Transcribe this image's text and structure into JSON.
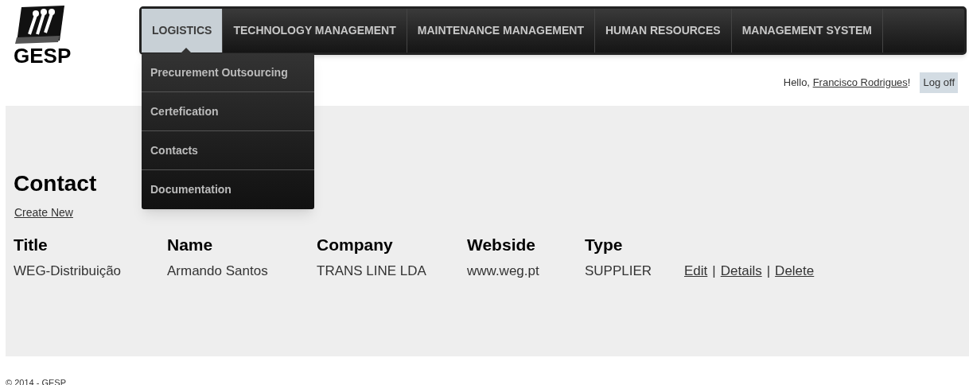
{
  "logo": {
    "text": "GESP"
  },
  "nav": [
    {
      "label": "LOGISTICS",
      "selected": true
    },
    {
      "label": "TECHNOLOGY MANAGEMENT",
      "selected": false
    },
    {
      "label": "MAINTENANCE MANAGEMENT",
      "selected": false
    },
    {
      "label": "HUMAN RESOURCES",
      "selected": false
    },
    {
      "label": "MANAGEMENT SYSTEM",
      "selected": false
    }
  ],
  "dropdown": [
    "Precurement Outsourcing",
    "Certefication",
    "Contacts",
    "Documentation"
  ],
  "user": {
    "greeting": "Hello,",
    "name": "Francisco Rodrigues",
    "suffix": "!",
    "logoff": "Log off"
  },
  "page": {
    "title": "Contact",
    "create_link": "Create New"
  },
  "table": {
    "columns": [
      "Title",
      "Name",
      "Company",
      "Webside",
      "Type"
    ],
    "rows": [
      {
        "cells": [
          "WEG-Distribuição",
          "Armando Santos",
          "TRANS LINE LDA",
          "www.weg.pt",
          "SUPPLIER"
        ],
        "actions": [
          "Edit",
          "Details",
          "Delete"
        ],
        "separators": [
          "|",
          "|"
        ]
      }
    ]
  },
  "footer": "© 2014 - GESP"
}
